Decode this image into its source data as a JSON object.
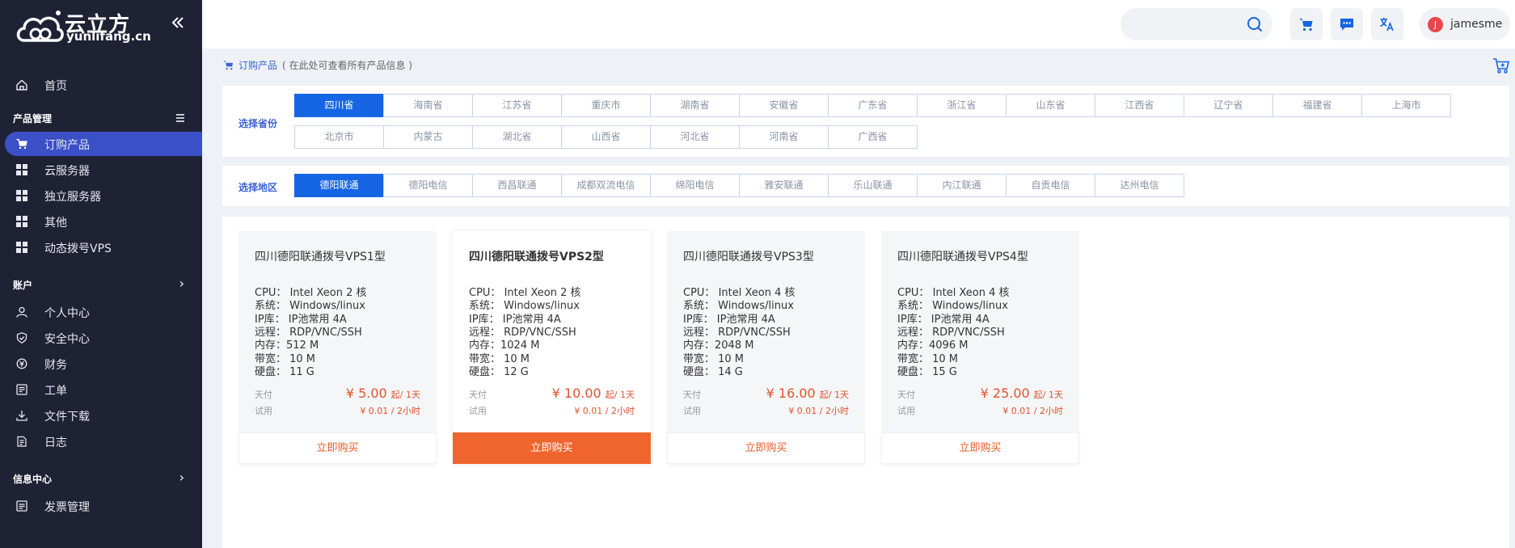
{
  "brand": {
    "name_cn": "云立方",
    "name_en": "yunlifang.cn",
    "accent": "#1565e5",
    "sidebar_bg": "#1f2235",
    "price_color": "#e2542c"
  },
  "sidebar": {
    "home": "首页",
    "section_products": "产品管理",
    "items_products": [
      "订购产品",
      "云服务器",
      "独立服务器",
      "其他",
      "动态拨号VPS"
    ],
    "section_account": "账户",
    "items_account": [
      "个人中心",
      "安全中心",
      "财务",
      "工单",
      "文件下载",
      "日志"
    ],
    "section_info": "信息中心",
    "items_info": [
      "发票管理"
    ]
  },
  "topbar": {
    "username": "jamesme",
    "avatar_letter": "J"
  },
  "breadcrumb": {
    "title": "订购产品",
    "note": "( 在此处可查看所有产品信息 )"
  },
  "province": {
    "label": "选择省份",
    "selected": "四川省",
    "row1": [
      "四川省",
      "海南省",
      "江苏省",
      "重庆市",
      "湖南省",
      "安徽省",
      "广东省",
      "浙江省",
      "山东省",
      "江西省",
      "辽宁省",
      "福建省",
      "上海市"
    ],
    "row2": [
      "北京市",
      "内蒙古",
      "湖北省",
      "山西省",
      "河北省",
      "河南省",
      "广西省"
    ]
  },
  "region": {
    "label": "选择地区",
    "selected": "德阳联通",
    "items": [
      "德阳联通",
      "德阳电信",
      "西昌联通",
      "成都双流电信",
      "绵阳电信",
      "雅安联通",
      "乐山联通",
      "内江联通",
      "自贡电信",
      "达州电信"
    ]
  },
  "products": [
    {
      "title": "四川德阳联通拨号VPS1型",
      "cpu": "CPU：  Intel Xeon 2  核",
      "os": "系统：  Windows/linux",
      "ip": "IP库：  IP池常用 4A",
      "remote": "远程：  RDP/VNC/SSH",
      "mem": "内存：512 M",
      "bw": "带宽：  10 M",
      "disk": "硬盘：  11 G",
      "day_label": "天付",
      "price": "¥ 5.00",
      "price_unit": "起/ 1天",
      "trial_label": "试用",
      "trial": "¥ 0.01 / 2小时",
      "buy": "立即购买"
    },
    {
      "title": "四川德阳联通拨号VPS2型",
      "cpu": "CPU：  Intel Xeon 2  核",
      "os": "系统：  Windows/linux",
      "ip": "IP库：  IP池常用 4A",
      "remote": "远程：  RDP/VNC/SSH",
      "mem": "内存：1024 M",
      "bw": "带宽：  10 M",
      "disk": "硬盘：  12 G",
      "day_label": "天付",
      "price": "¥ 10.00",
      "price_unit": "起/ 1天",
      "trial_label": "试用",
      "trial": "¥ 0.01 / 2小时",
      "buy": "立即购买"
    },
    {
      "title": "四川德阳联通拨号VPS3型",
      "cpu": "CPU：  Intel Xeon 4  核",
      "os": "系统：  Windows/linux",
      "ip": "IP库：  IP池常用 4A",
      "remote": "远程：  RDP/VNC/SSH",
      "mem": "内存：2048 M",
      "bw": "带宽：  10 M",
      "disk": "硬盘：  14 G",
      "day_label": "天付",
      "price": "¥ 16.00",
      "price_unit": "起/ 1天",
      "trial_label": "试用",
      "trial": "¥ 0.01 / 2小时",
      "buy": "立即购买"
    },
    {
      "title": "四川德阳联通拨号VPS4型",
      "cpu": "CPU：  Intel Xeon 4  核",
      "os": "系统：  Windows/linux",
      "ip": "IP库：  IP池常用 4A",
      "remote": "远程：  RDP/VNC/SSH",
      "mem": "内存：4096 M",
      "bw": "带宽：  10 M",
      "disk": "硬盘：  15 G",
      "day_label": "天付",
      "price": "¥ 25.00",
      "price_unit": "起/ 1天",
      "trial_label": "试用",
      "trial": "¥ 0.01 / 2小时",
      "buy": "立即购买"
    }
  ]
}
